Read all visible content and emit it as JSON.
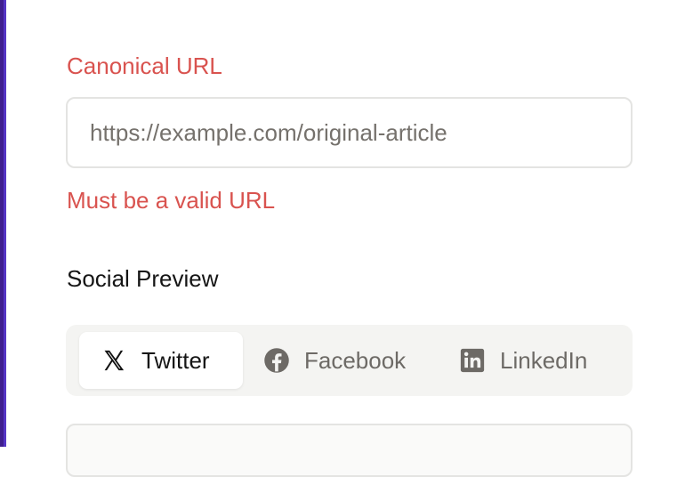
{
  "canonical": {
    "label": "Canonical URL",
    "placeholder": "https://example.com/original-article",
    "value": "",
    "error": "Must be a valid URL"
  },
  "social_preview": {
    "title": "Social Preview",
    "tabs": [
      {
        "label": "Twitter",
        "icon": "x-logo-icon",
        "active": true
      },
      {
        "label": "Facebook",
        "icon": "facebook-icon",
        "active": false
      },
      {
        "label": "LinkedIn",
        "icon": "linkedin-icon",
        "active": false
      }
    ]
  },
  "colors": {
    "error": "#d9534f",
    "text": "#151515",
    "muted": "#6d6a66",
    "tab_bar_bg": "#f4f4f2",
    "border": "#e4e4e2",
    "left_border": "#3f1f8f"
  }
}
